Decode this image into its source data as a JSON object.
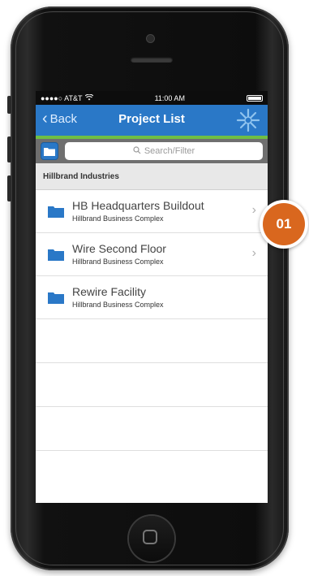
{
  "status_bar": {
    "carrier": "●●●●○ AT&T",
    "wifi_icon": "wifi-icon",
    "time": "11:00 AM",
    "battery_icon": "battery-icon"
  },
  "nav_bar": {
    "back_label": "Back",
    "title": "Project List",
    "logo_icon": "star-logo-icon"
  },
  "toolbar": {
    "folder_icon": "folder-icon",
    "search_placeholder": "Search/Filter"
  },
  "group": {
    "label": "Hillbrand Industries"
  },
  "projects": [
    {
      "name": "HB Headquarters Buildout",
      "location": "Hillbrand Business Complex",
      "has_chevron": true
    },
    {
      "name": "Wire Second Floor",
      "location": "Hillbrand Business Complex",
      "has_chevron": true
    },
    {
      "name": "Rewire Facility",
      "location": "Hillbrand Business Complex",
      "has_chevron": false
    }
  ],
  "callout": {
    "label": "01",
    "color": "#d9671e"
  },
  "colors": {
    "nav_blue": "#2a78c7",
    "accent_green": "#6fbe44"
  }
}
